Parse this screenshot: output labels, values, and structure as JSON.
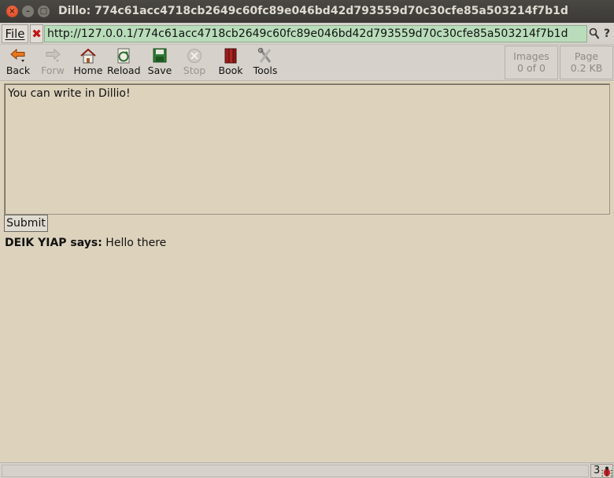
{
  "window": {
    "title": "Dillo: 774c61acc4718cb2649c60fc89e046bd42d793559d70c30cfe85a503214f7b1d",
    "close_glyph": "×",
    "minimize_glyph": "–",
    "maximize_glyph": "□"
  },
  "location": {
    "file_label": "File",
    "clear_glyph": "✖",
    "url": "http://127.0.0.1/774c61acc4718cb2649c60fc89e046bd42d793559d70c30cfe85a503214f7b1d",
    "search_glyph": "🔍",
    "help_glyph": "?"
  },
  "toolbar": {
    "back": "Back",
    "forw": "Forw",
    "home": "Home",
    "reload": "Reload",
    "save": "Save",
    "stop": "Stop",
    "book": "Book",
    "tools": "Tools",
    "images_label": "Images",
    "images_value": "0 of 0",
    "page_label": "Page",
    "page_value": "0.2 KB"
  },
  "content": {
    "textarea_value": "You can write in Dillio!",
    "submit_label": "Submit",
    "message_author": "DEIK YIAP says:",
    "message_text": "Hello there"
  },
  "status": {
    "text": "",
    "bug_count": "3"
  },
  "colors": {
    "page_background": "#ddd3bd",
    "url_background": "#b9ddba",
    "chrome": "#d6d2cb"
  },
  "icons": [
    "back-arrow-icon",
    "forward-arrow-icon",
    "home-icon",
    "reload-icon",
    "save-disk-icon",
    "stop-icon",
    "bookmarks-icon",
    "tools-icon",
    "clear-url-icon",
    "search-icon",
    "help-icon",
    "bug-icon"
  ]
}
